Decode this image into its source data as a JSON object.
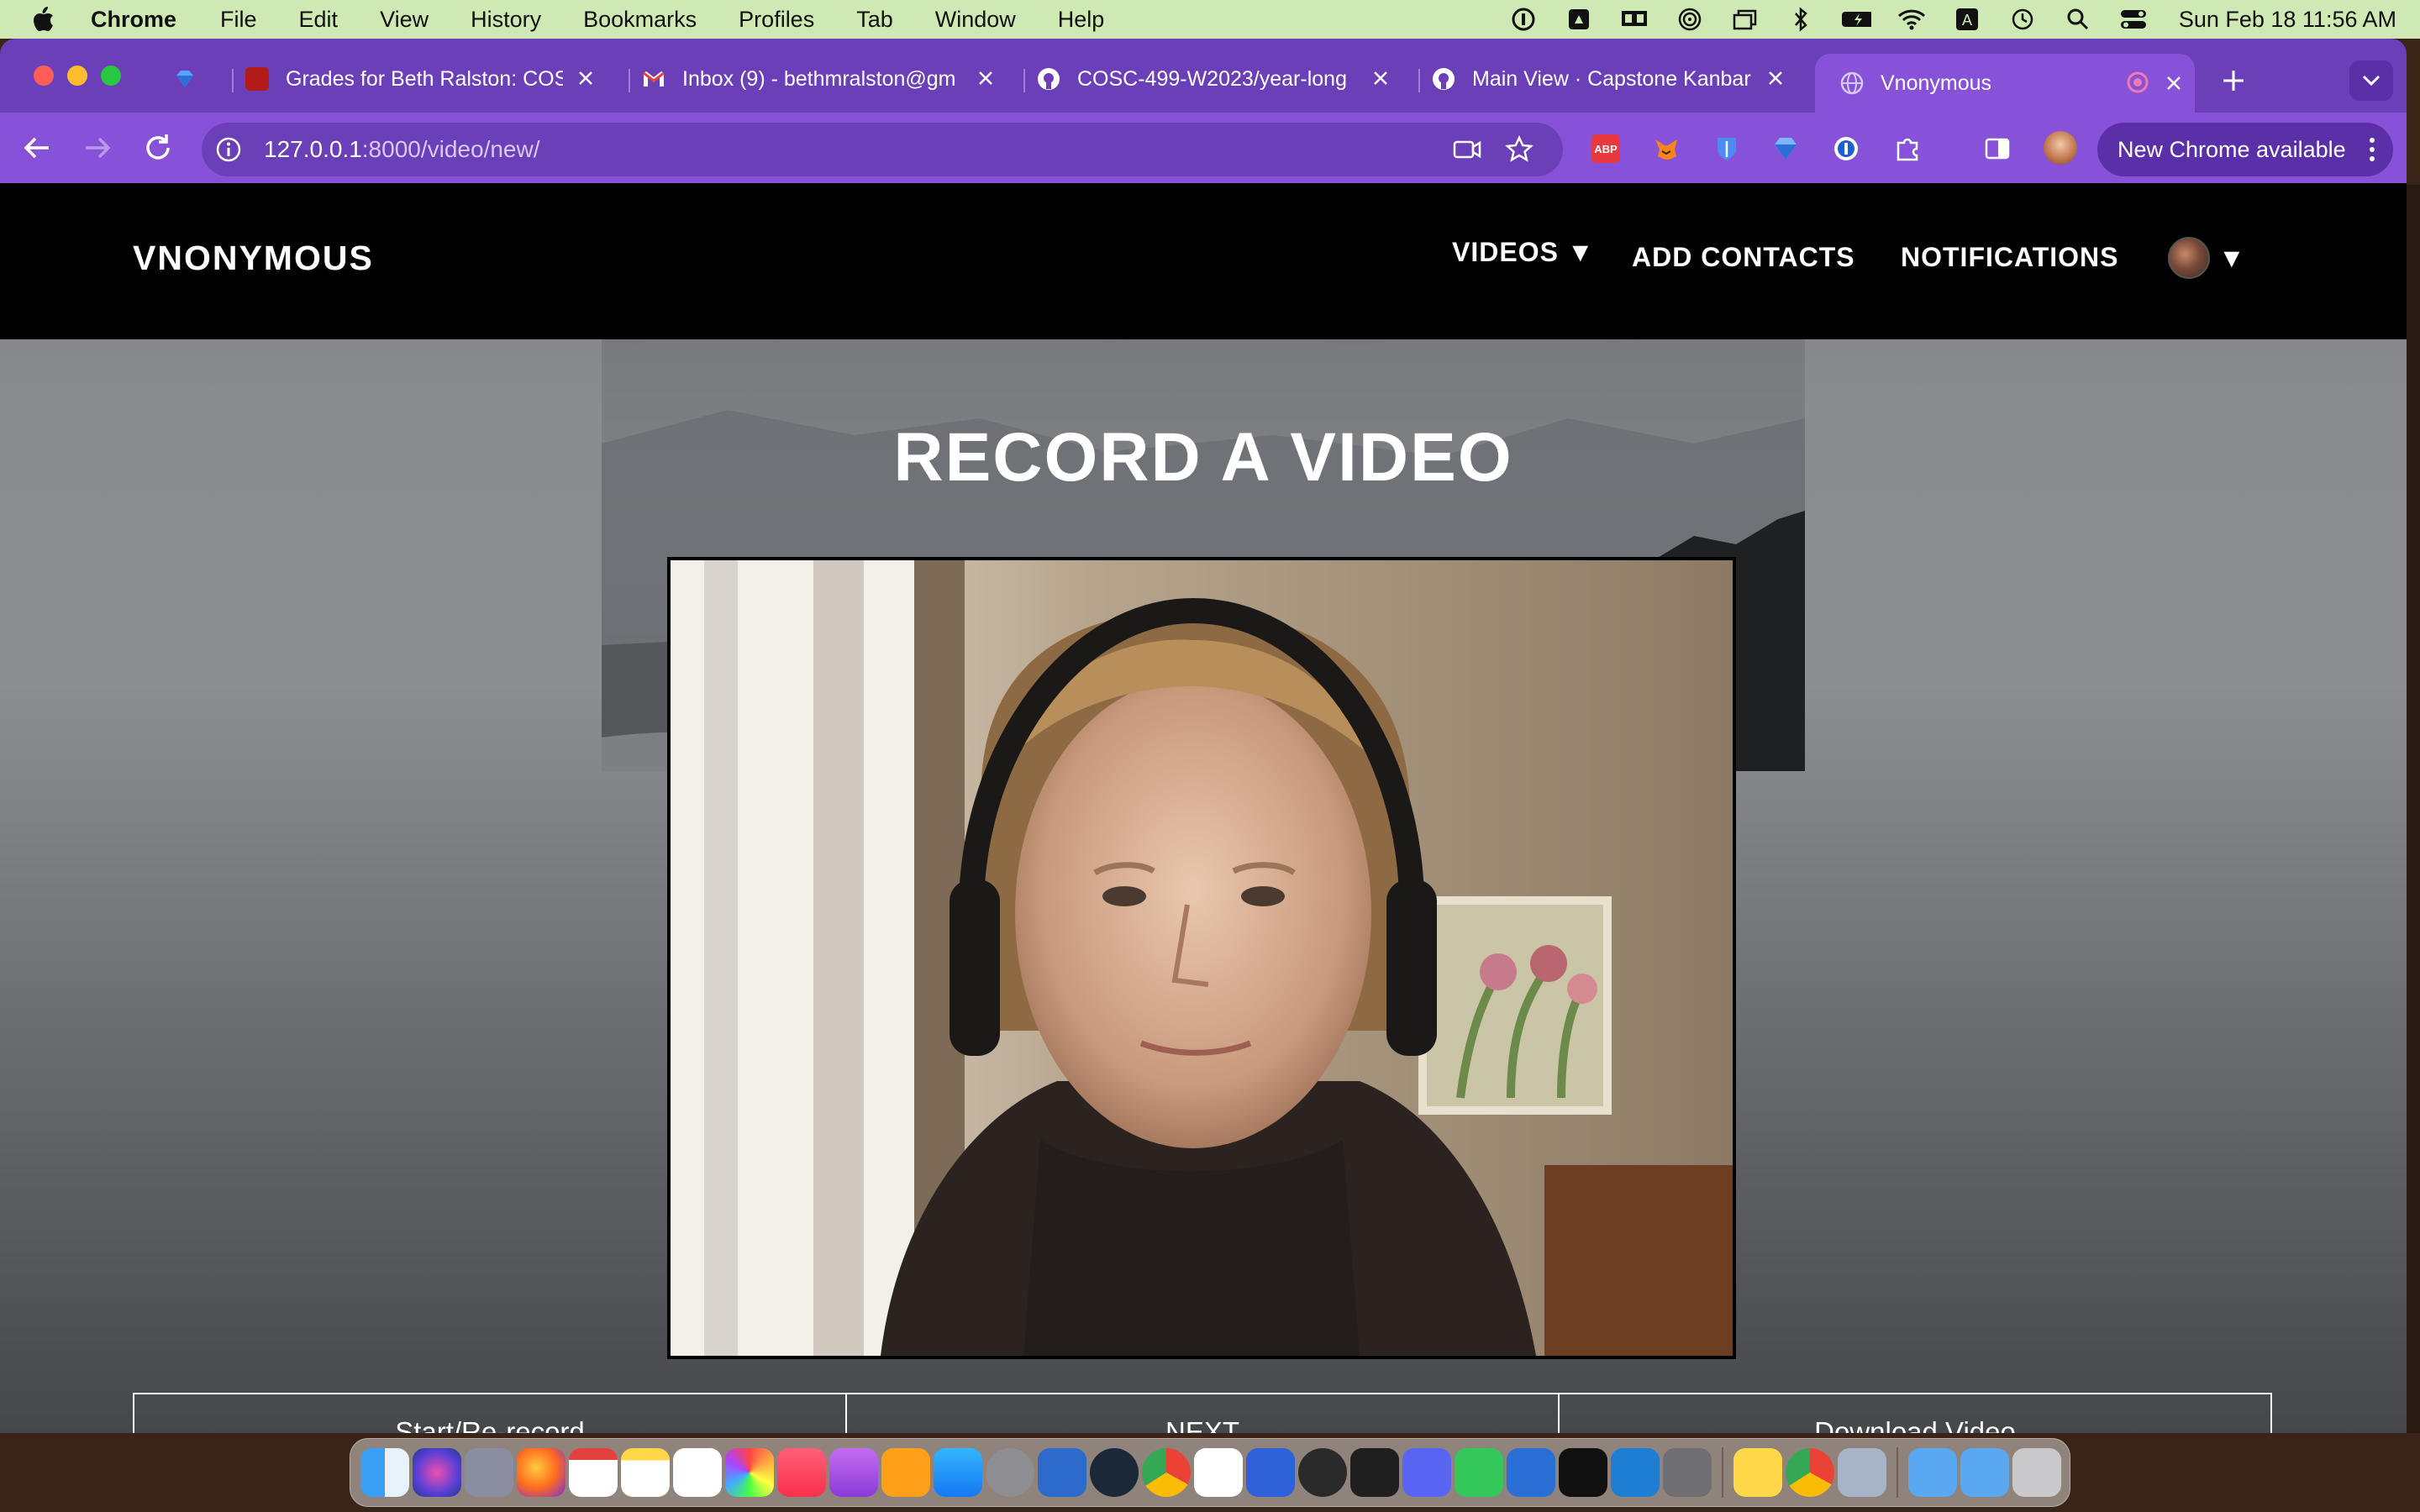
{
  "menubar": {
    "app_name": "Chrome",
    "items": [
      "File",
      "Edit",
      "View",
      "History",
      "Bookmarks",
      "Profiles",
      "Tab",
      "Window",
      "Help"
    ],
    "clock": "Sun Feb 18  11:56 AM"
  },
  "tabs": [
    {
      "title": "",
      "icon": "sketch-diamond-icon"
    },
    {
      "title": "Grades for Beth Ralston: COS",
      "icon": "ubc-canvas-icon"
    },
    {
      "title": "Inbox (9) - bethmralston@gm",
      "icon": "gmail-icon"
    },
    {
      "title": "COSC-499-W2023/year-long",
      "icon": "github-icon"
    },
    {
      "title": "Main View · Capstone Kanbar",
      "icon": "github-icon"
    },
    {
      "title": "Vnonymous",
      "icon": "globe-icon",
      "active": true
    }
  ],
  "address_bar": {
    "host": "127.0.0.1",
    "path": ":8000/video/new/"
  },
  "toolbar": {
    "update_label": "New Chrome available"
  },
  "site": {
    "brand": "VNONYMOUS",
    "nav": {
      "videos": "VIDEOS ▼",
      "add_contacts": "ADD CONTACTS",
      "notifications": "NOTIFICATIONS",
      "profile_caret": "▼"
    },
    "page_title": "RECORD A VIDEO",
    "buttons": {
      "record": "Start/Re-record",
      "next": "NEXT",
      "download": "Download Video"
    }
  },
  "colors": {
    "menubar": "#cfe9b4",
    "tabstrip": "#6b3fb8",
    "toolbar": "#8752d8",
    "site_header": "#000000"
  }
}
